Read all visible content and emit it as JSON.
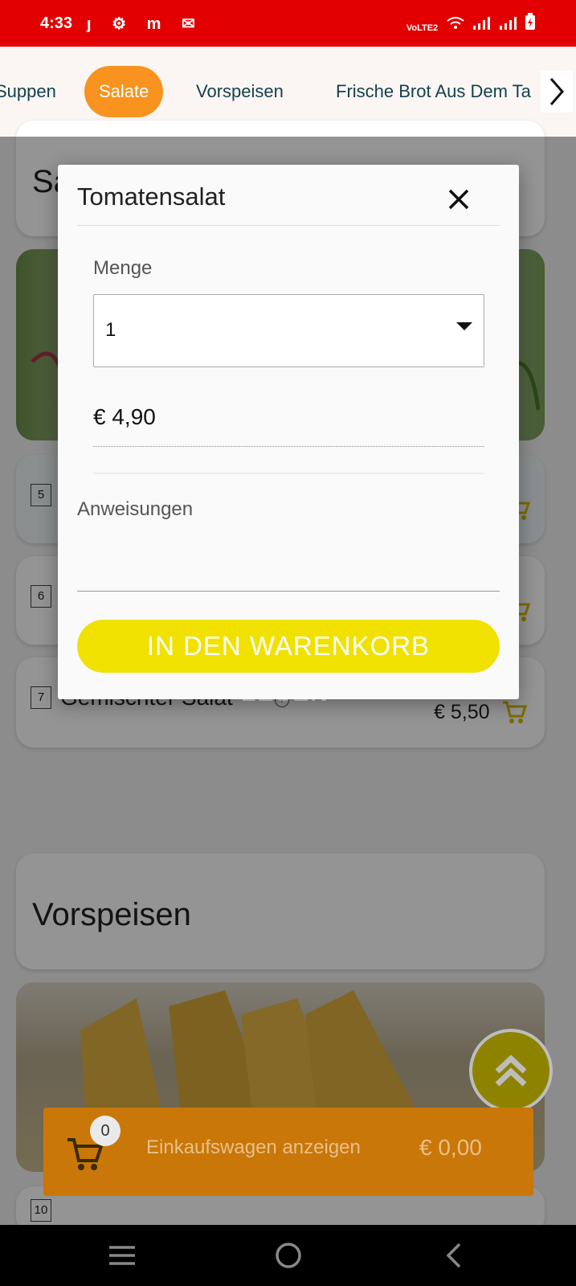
{
  "status_bar": {
    "time": "4:33",
    "notification_icons": [
      "j-icon",
      "gear-icon",
      "m-icon",
      "mail-icon"
    ],
    "system_icons": [
      "volte-icon",
      "wifi-icon",
      "signal-icon",
      "signal-icon",
      "battery-icon"
    ],
    "volte_label": "VoLTE2"
  },
  "categories": {
    "items": [
      {
        "label": "Suppen",
        "active": false
      },
      {
        "label": "Salate",
        "active": true
      },
      {
        "label": "Vorspeisen",
        "active": false
      },
      {
        "label": "Frische Brot Aus Dem Ta",
        "active": false
      }
    ],
    "accent": "#f7931e"
  },
  "background": {
    "section_salate_partial": "Sa",
    "items": [
      {
        "number": "5",
        "name": "",
        "price": ""
      },
      {
        "number": "6",
        "name": "",
        "price": ""
      },
      {
        "number": "7",
        "name": "Gemischter Salat",
        "price": "€ 5,50"
      }
    ],
    "section_vorspeisen": "Vorspeisen",
    "next_number_partial": "10",
    "ghost_text": "LESEN"
  },
  "dialog": {
    "title": "Tomatensalat",
    "quantity_label": "Menge",
    "quantity_value": "1",
    "price": "€ 4,90",
    "instructions_label": "Anweisungen",
    "instructions_value": "",
    "add_button": "IN DEN WARENKORB",
    "button_color": "#f1e100"
  },
  "cart_bar": {
    "count": "0",
    "label": "Einkaufswagen anzeigen",
    "total": "€ 0,00"
  },
  "nav_bar": {
    "buttons": [
      "menu-icon",
      "home-icon",
      "back-icon"
    ]
  }
}
